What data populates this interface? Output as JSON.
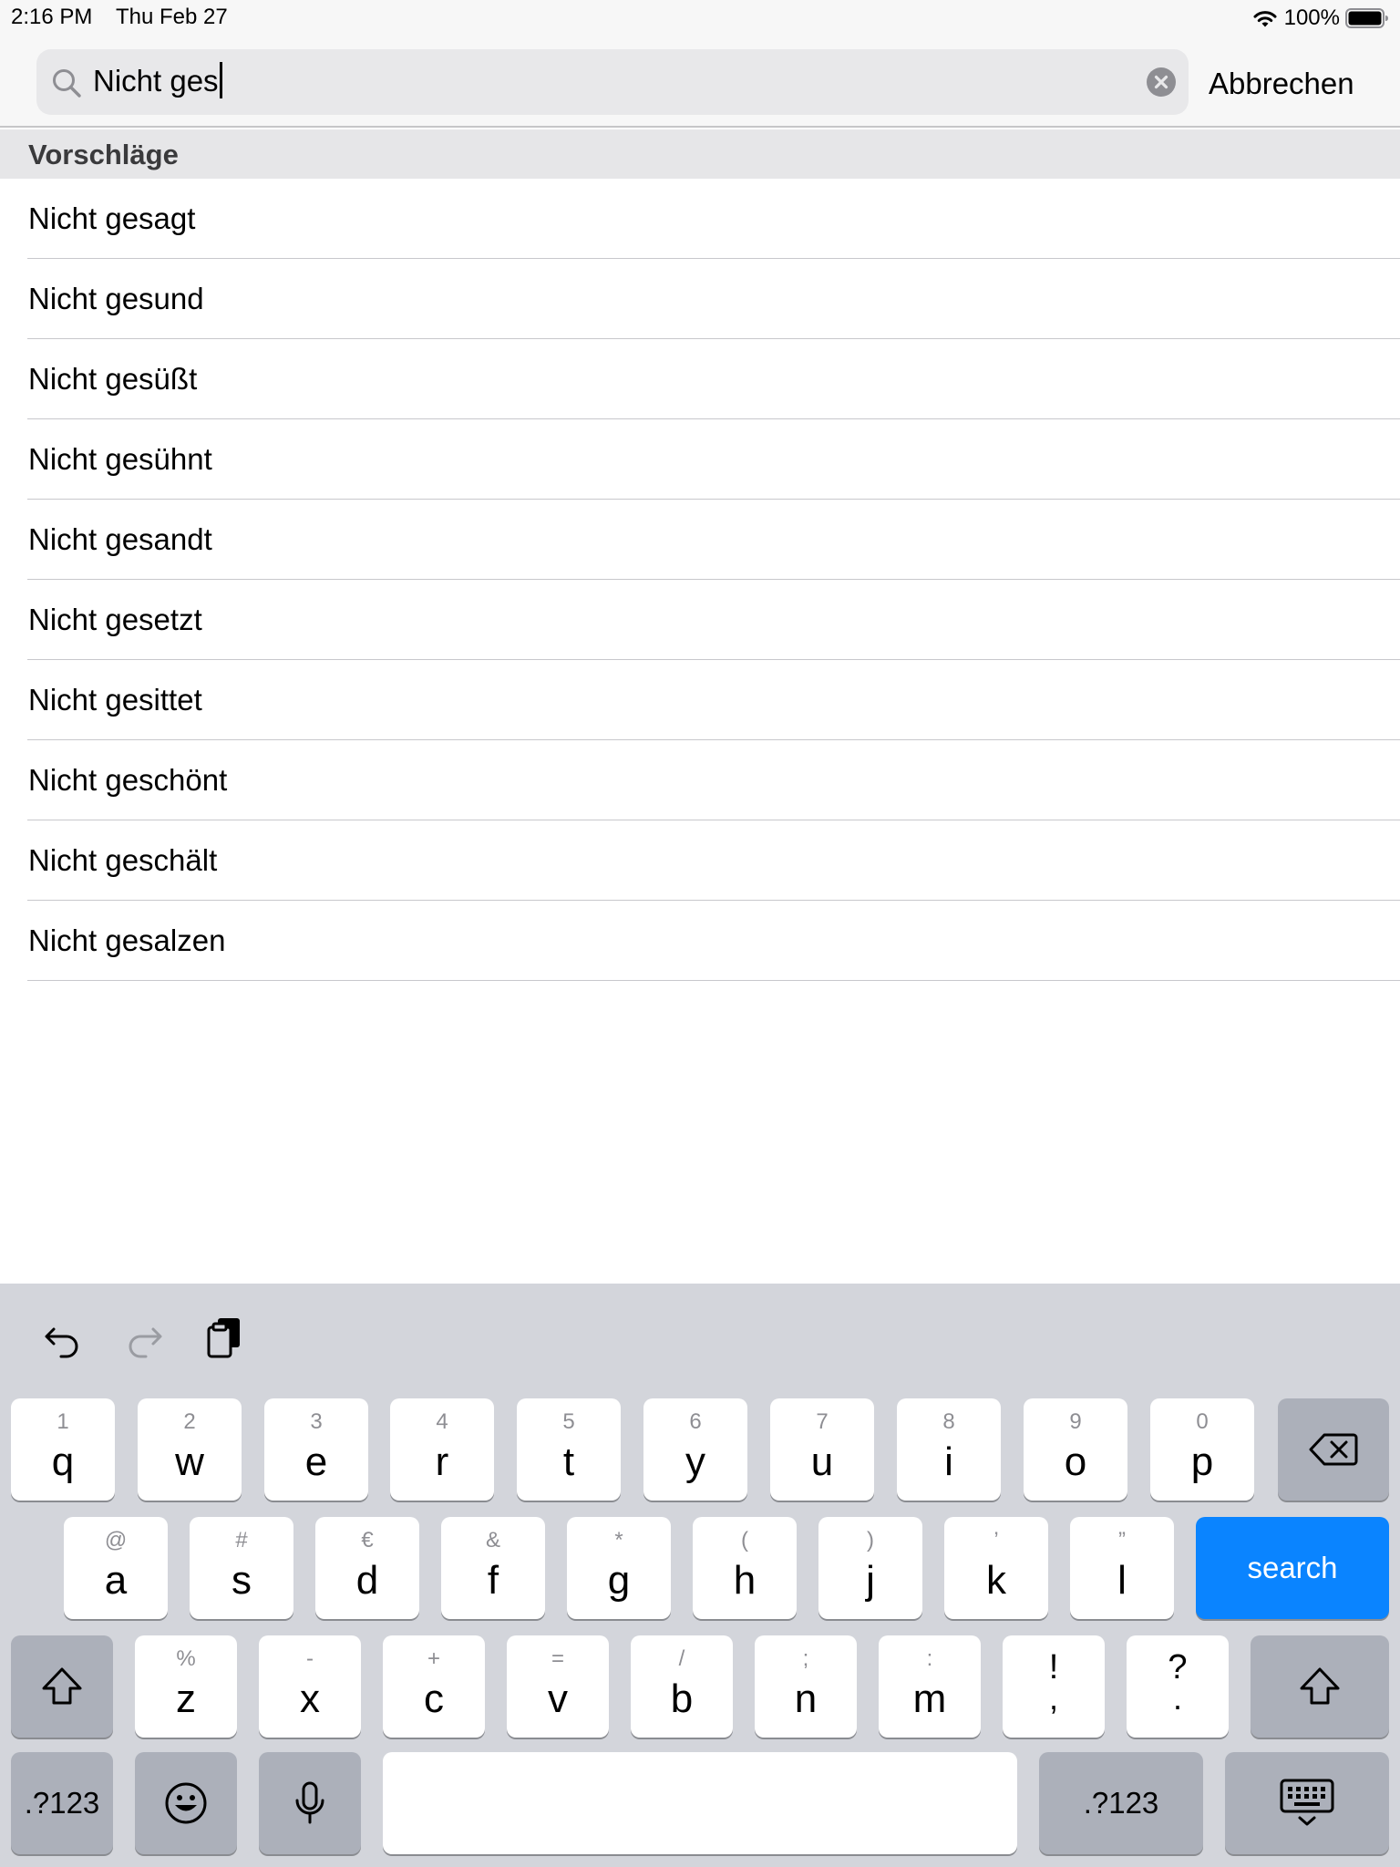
{
  "status_bar": {
    "time": "2:16 PM",
    "date": "Thu Feb 27",
    "battery_percent": "100%",
    "battery_level": 1.0,
    "wifi_icon": "wifi-icon",
    "battery_icon": "battery-icon"
  },
  "search": {
    "value": "Nicht ges",
    "search_icon": "search-icon",
    "clear_icon": "clear-icon",
    "cancel_label": "Abbrechen"
  },
  "section": {
    "title": "Vorschläge"
  },
  "suggestions": [
    "Nicht gesagt",
    "Nicht gesund",
    "Nicht gesüßt",
    "Nicht gesühnt",
    "Nicht gesandt",
    "Nicht gesetzt",
    "Nicht gesittet",
    "Nicht geschönt",
    "Nicht geschält",
    "Nicht gesalzen"
  ],
  "keyboard": {
    "toolbar": [
      "undo-icon",
      "redo-icon",
      "paste-icon"
    ],
    "row1": [
      {
        "primary": "q",
        "secondary": "1"
      },
      {
        "primary": "w",
        "secondary": "2"
      },
      {
        "primary": "e",
        "secondary": "3"
      },
      {
        "primary": "r",
        "secondary": "4"
      },
      {
        "primary": "t",
        "secondary": "5"
      },
      {
        "primary": "y",
        "secondary": "6"
      },
      {
        "primary": "u",
        "secondary": "7"
      },
      {
        "primary": "i",
        "secondary": "8"
      },
      {
        "primary": "o",
        "secondary": "9"
      },
      {
        "primary": "p",
        "secondary": "0"
      }
    ],
    "row2": [
      {
        "primary": "a",
        "secondary": "@"
      },
      {
        "primary": "s",
        "secondary": "#"
      },
      {
        "primary": "d",
        "secondary": "€"
      },
      {
        "primary": "f",
        "secondary": "&"
      },
      {
        "primary": "g",
        "secondary": "*"
      },
      {
        "primary": "h",
        "secondary": "("
      },
      {
        "primary": "j",
        "secondary": ")"
      },
      {
        "primary": "k",
        "secondary": "’"
      },
      {
        "primary": "l",
        "secondary": "”"
      }
    ],
    "row3": [
      {
        "primary": "z",
        "secondary": "%"
      },
      {
        "primary": "x",
        "secondary": "-"
      },
      {
        "primary": "c",
        "secondary": "+"
      },
      {
        "primary": "v",
        "secondary": "="
      },
      {
        "primary": "b",
        "secondary": "/"
      },
      {
        "primary": "n",
        "secondary": ";"
      },
      {
        "primary": "m",
        "secondary": ":"
      },
      {
        "primary": ",",
        "secondary": "!"
      },
      {
        "primary": ".",
        "secondary": "?"
      }
    ],
    "search_label": "search",
    "numbers_label": ".?123",
    "accent_color": "#0a84ff"
  }
}
